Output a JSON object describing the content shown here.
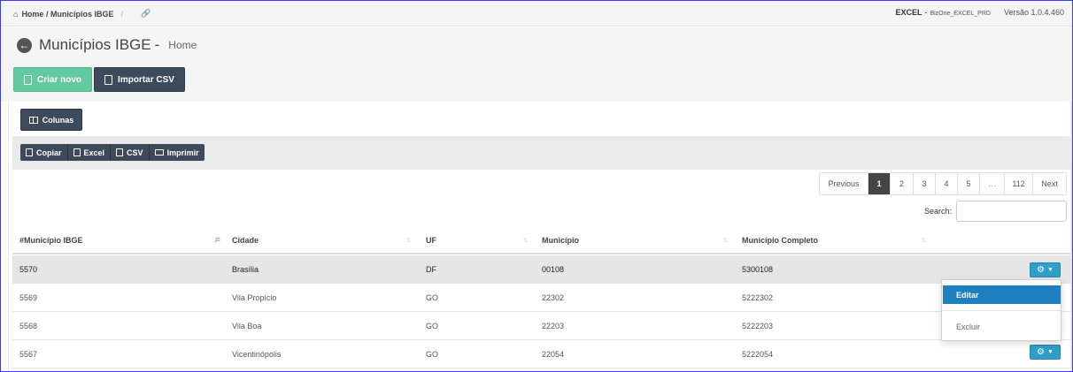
{
  "breadcrumb": {
    "home_icon": "home-icon",
    "path": "Home / Municípios IBGE",
    "separator": "/",
    "link_icon": "link-icon"
  },
  "env": {
    "app": "EXCEL",
    "dash": "-",
    "db": "BizOne_EXCEL_PRD",
    "version": "Versão 1.0.4.460"
  },
  "page": {
    "title": "Municípios IBGE",
    "dash": "-",
    "subtitle": "Home",
    "back_icon": "arrow-left-circle-icon"
  },
  "toolbar": {
    "new_label": "Criar novo",
    "import_label": "Importar CSV",
    "columns_label": "Colunas"
  },
  "exports": [
    {
      "label": "Copiar",
      "icon": "copy-icon"
    },
    {
      "label": "Excel",
      "icon": "file-excel-icon"
    },
    {
      "label": "CSV",
      "icon": "file-csv-icon"
    },
    {
      "label": "Imprimir",
      "icon": "print-icon"
    }
  ],
  "pagination": {
    "previous": "Previous",
    "pages": [
      "1",
      "2",
      "3",
      "4",
      "5",
      "…",
      "112"
    ],
    "next": "Next",
    "current": "1"
  },
  "search": {
    "label": "Search:",
    "value": ""
  },
  "table": {
    "headers": [
      "#Município IBGE",
      "Cidade",
      "UF",
      "Município",
      "Município Completo"
    ],
    "rows": [
      [
        "5570",
        "Brasília",
        "DF",
        "00108",
        "5300108"
      ],
      [
        "5569",
        "Vila Propício",
        "GO",
        "22302",
        "5222302"
      ],
      [
        "5568",
        "Vila Boa",
        "GO",
        "22203",
        "5222203"
      ],
      [
        "5567",
        "Vicentinópolis",
        "GO",
        "22054",
        "5222054"
      ]
    ]
  },
  "row_menu": {
    "edit": "Editar",
    "delete": "Excluir"
  },
  "colors": {
    "green": "#63c9a0",
    "dark": "#3d4a5c",
    "blue": "#2f9fc7",
    "menu_active": "#1f7fbf"
  }
}
